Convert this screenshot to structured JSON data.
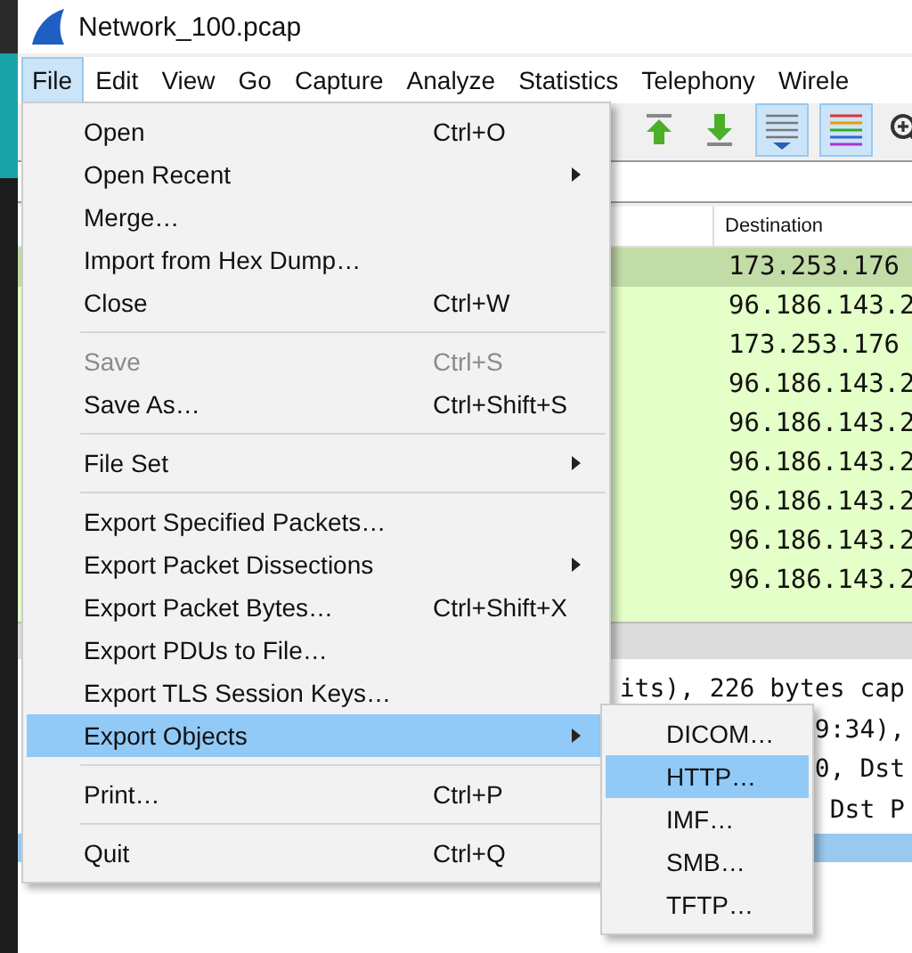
{
  "window": {
    "title": "Network_100.pcap"
  },
  "menu_bar": [
    {
      "label": "File",
      "selected": true
    },
    {
      "label": "Edit",
      "selected": false
    },
    {
      "label": "View",
      "selected": false
    },
    {
      "label": "Go",
      "selected": false
    },
    {
      "label": "Capture",
      "selected": false
    },
    {
      "label": "Analyze",
      "selected": false
    },
    {
      "label": "Statistics",
      "selected": false
    },
    {
      "label": "Telephony",
      "selected": false
    },
    {
      "label": "Wirele",
      "selected": false
    }
  ],
  "toolbar": [
    {
      "kind": "up",
      "selected": false
    },
    {
      "kind": "down",
      "selected": false
    },
    {
      "kind": "autoscroll",
      "selected": true
    },
    {
      "kind": "colorize",
      "selected": true
    },
    {
      "kind": "zoomin",
      "selected": false
    }
  ],
  "packet_list": {
    "columns": [
      "Destination"
    ],
    "rows": [
      {
        "destination": "173.253.176",
        "selected": true
      },
      {
        "destination": "96.186.143.2",
        "selected": false
      },
      {
        "destination": "173.253.176",
        "selected": false
      },
      {
        "destination": "96.186.143.2",
        "selected": false
      },
      {
        "destination": "96.186.143.2",
        "selected": false
      },
      {
        "destination": "96.186.143.2",
        "selected": false
      },
      {
        "destination": "96.186.143.2",
        "selected": false
      },
      {
        "destination": "96.186.143.2",
        "selected": false
      },
      {
        "destination": "96.186.143.2",
        "selected": false
      }
    ]
  },
  "packet_detail": {
    "lines": [
      {
        "text": "its), 226 bytes cap",
        "selected": false
      },
      {
        "text": "9:34),",
        "selected": false
      },
      {
        "text": "0, Dst",
        "selected": false
      },
      {
        "text": "Dst P",
        "selected": false
      },
      {
        "selected": true
      }
    ]
  },
  "file_menu": [
    {
      "kind": "item",
      "label": "Open",
      "shortcut": "Ctrl+O",
      "submenu": false,
      "disabled": false,
      "selected": false
    },
    {
      "kind": "item",
      "label": "Open Recent",
      "submenu": true,
      "disabled": false,
      "selected": false
    },
    {
      "kind": "item",
      "label": "Merge…",
      "submenu": false,
      "disabled": false,
      "selected": false
    },
    {
      "kind": "item",
      "label": "Import from Hex Dump…",
      "submenu": false,
      "disabled": false,
      "selected": false
    },
    {
      "kind": "item",
      "label": "Close",
      "shortcut": "Ctrl+W",
      "submenu": false,
      "disabled": false,
      "selected": false
    },
    {
      "kind": "separator"
    },
    {
      "kind": "item",
      "label": "Save",
      "shortcut": "Ctrl+S",
      "submenu": false,
      "disabled": true,
      "selected": false
    },
    {
      "kind": "item",
      "label": "Save As…",
      "shortcut": "Ctrl+Shift+S",
      "submenu": false,
      "disabled": false,
      "selected": false
    },
    {
      "kind": "separator"
    },
    {
      "kind": "item",
      "label": "File Set",
      "submenu": true,
      "disabled": false,
      "selected": false
    },
    {
      "kind": "separator"
    },
    {
      "kind": "item",
      "label": "Export Specified Packets…",
      "submenu": false,
      "disabled": false,
      "selected": false
    },
    {
      "kind": "item",
      "label": "Export Packet Dissections",
      "submenu": true,
      "disabled": false,
      "selected": false
    },
    {
      "kind": "item",
      "label": "Export Packet Bytes…",
      "shortcut": "Ctrl+Shift+X",
      "submenu": false,
      "disabled": false,
      "selected": false
    },
    {
      "kind": "item",
      "label": "Export PDUs to File…",
      "submenu": false,
      "disabled": false,
      "selected": false
    },
    {
      "kind": "item",
      "label": "Export TLS Session Keys…",
      "submenu": false,
      "disabled": false,
      "selected": false
    },
    {
      "kind": "item",
      "label": "Export Objects",
      "submenu": true,
      "disabled": false,
      "selected": true,
      "children": [
        {
          "label": "DICOM…",
          "selected": false
        },
        {
          "label": "HTTP…",
          "selected": true
        },
        {
          "label": "IMF…",
          "selected": false
        },
        {
          "label": "SMB…",
          "selected": false
        },
        {
          "label": "TFTP…",
          "selected": false
        }
      ]
    },
    {
      "kind": "separator"
    },
    {
      "kind": "item",
      "label": "Print…",
      "shortcut": "Ctrl+P",
      "submenu": false,
      "disabled": false,
      "selected": false
    },
    {
      "kind": "separator"
    },
    {
      "kind": "item",
      "label": "Quit",
      "shortcut": "Ctrl+Q",
      "submenu": false,
      "disabled": false,
      "selected": false
    }
  ]
}
